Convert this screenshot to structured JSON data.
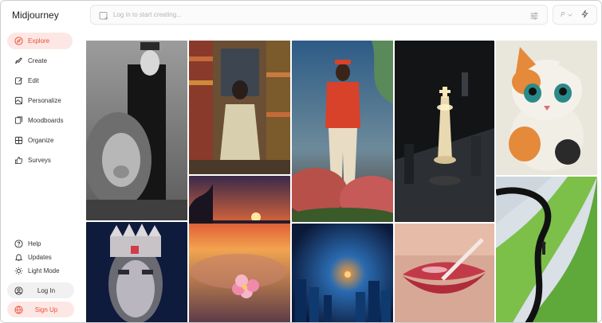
{
  "app": {
    "name": "Midjourney"
  },
  "nav": [
    {
      "label": "Explore",
      "icon": "compass-icon",
      "active": true
    },
    {
      "label": "Create",
      "icon": "brush-icon",
      "active": false
    },
    {
      "label": "Edit",
      "icon": "edit-icon",
      "active": false
    },
    {
      "label": "Personalize",
      "icon": "palette-icon",
      "active": false
    },
    {
      "label": "Moodboards",
      "icon": "moodboard-icon",
      "active": false
    },
    {
      "label": "Organize",
      "icon": "grid-icon",
      "active": false
    },
    {
      "label": "Surveys",
      "icon": "thumbs-up-icon",
      "active": false
    }
  ],
  "footer": {
    "help": "Help",
    "updates": "Updates",
    "light_mode": "Light Mode",
    "login": "Log In",
    "signup": "Sign Up"
  },
  "prompt": {
    "placeholder": "Log in to start creating..."
  },
  "topright": {
    "p_label": "P"
  },
  "colors": {
    "accent": "#e8503a",
    "accent_bg": "#fde7e4"
  }
}
